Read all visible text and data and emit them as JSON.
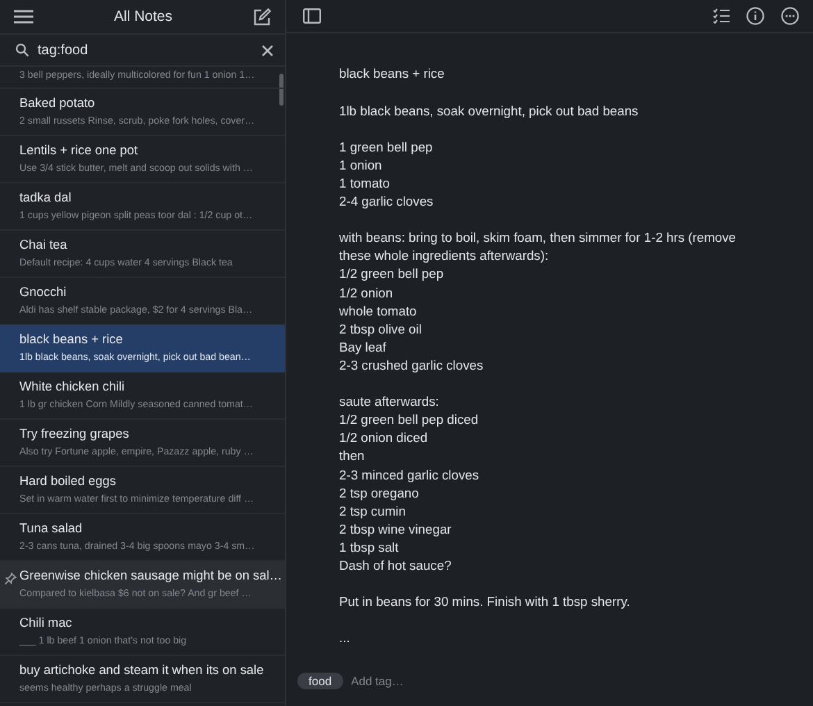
{
  "sidebar": {
    "title": "All Notes",
    "search": {
      "value": "tag:food"
    },
    "notes": [
      {
        "preview": "3 bell peppers, ideally multicolored for fun 1 onion 1…",
        "selected": false,
        "pinned": false,
        "hovered": false
      },
      {
        "title": "Baked potato",
        "preview": "2 small russets Rinse, scrub, poke fork holes, cover…",
        "selected": false,
        "pinned": false,
        "hovered": false
      },
      {
        "title": "Lentils + rice one pot",
        "preview": "Use 3/4 stick butter, melt and scoop out solids with …",
        "selected": false,
        "pinned": false,
        "hovered": false
      },
      {
        "title": "tadka dal",
        "preview": "1 cups yellow pigeon split peas toor dal : 1/2 cup ot…",
        "selected": false,
        "pinned": false,
        "hovered": false
      },
      {
        "title": "Chai tea",
        "preview": "Default recipe: 4 cups water 4 servings Black tea",
        "selected": false,
        "pinned": false,
        "hovered": false
      },
      {
        "title": "Gnocchi",
        "preview": "Aldi has shelf stable package, $2 for 4 servings Bla…",
        "selected": false,
        "pinned": false,
        "hovered": false
      },
      {
        "title": "black beans + rice",
        "preview": "1lb black beans, soak overnight, pick out bad bean…",
        "selected": true,
        "pinned": false,
        "hovered": false
      },
      {
        "title": "White chicken chili",
        "preview": "1 lb gr chicken Corn Mildly seasoned canned tomat…",
        "selected": false,
        "pinned": false,
        "hovered": false
      },
      {
        "title": "Try freezing grapes",
        "preview": "Also try Fortune apple, empire, Pazazz apple, ruby …",
        "selected": false,
        "pinned": false,
        "hovered": false
      },
      {
        "title": "Hard boiled eggs",
        "preview": "Set in warm water first to minimize temperature diff …",
        "selected": false,
        "pinned": false,
        "hovered": false
      },
      {
        "title": "Tuna salad",
        "preview": "2-3 cans tuna, drained 3-4 big spoons mayo 3-4 sm…",
        "selected": false,
        "pinned": false,
        "hovered": false
      },
      {
        "title": "Greenwise chicken sausage might be on sal…",
        "preview": "Compared to kielbasa $6 not on sale? And gr beef …",
        "selected": false,
        "pinned": true,
        "hovered": true
      },
      {
        "title": "Chili mac",
        "preview": "___ 1 lb beef 1 onion that's not too big",
        "selected": false,
        "pinned": false,
        "hovered": false
      },
      {
        "title": "buy artichoke and steam it when its on sale",
        "preview": "seems healthy perhaps a struggle meal",
        "selected": false,
        "pinned": false,
        "hovered": false
      }
    ]
  },
  "editor": {
    "paragraphs": [
      [
        "black beans + rice"
      ],
      [
        "1lb black beans, soak overnight, pick out bad beans"
      ],
      [
        "1 green bell pep",
        "1 onion",
        "1 tomato",
        "2-4 garlic cloves"
      ],
      [
        "with beans: bring to boil, skim foam, then simmer for 1-2 hrs (remove these whole ingredients afterwards):",
        "1/2 green bell pep",
        "1/2 onion",
        "whole tomato",
        "2 tbsp olive oil",
        "Bay leaf",
        "2-3 crushed garlic cloves"
      ],
      [
        "saute afterwards:",
        "1/2 green bell pep diced",
        "1/2 onion diced",
        "then",
        "2-3 minced garlic cloves",
        "2 tsp oregano",
        "2 tsp cumin",
        "2 tbsp wine vinegar",
        "1 tbsp salt",
        "Dash of hot sauce?"
      ],
      [
        "Put in beans for 30 mins. Finish with 1 tbsp sherry."
      ],
      [
        "..."
      ]
    ],
    "tags": [
      "food"
    ],
    "tag_placeholder": "Add tag…"
  }
}
